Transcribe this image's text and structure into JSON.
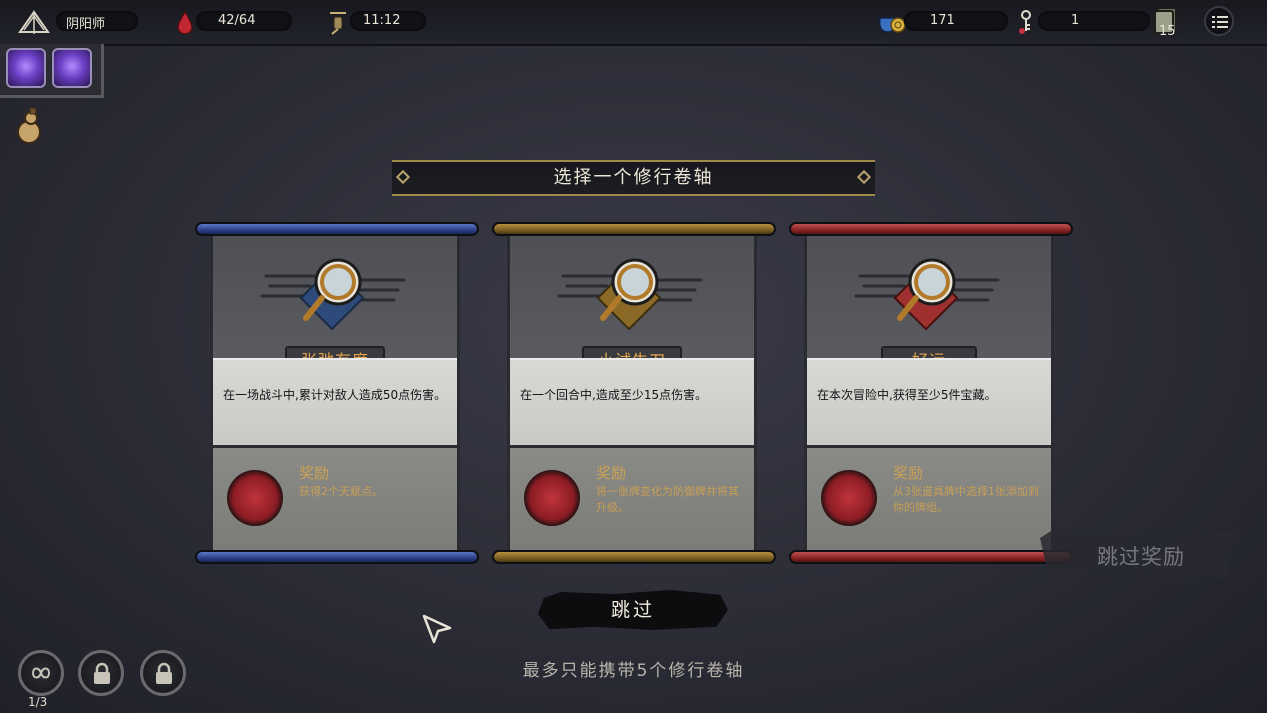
{
  "topbar": {
    "character_name": "阴阳师",
    "hp": "42/64",
    "time": "11:12",
    "gold": "171",
    "keys": "1",
    "deck_count": "15",
    "icons": {
      "character": "yin-yang-fan-icon",
      "hp": "blood-drop-icon",
      "time": "lantern-icon",
      "gold": "coin-pouch-icon",
      "keys": "key-icon",
      "deck": "deck-icon",
      "menu": "menu-list-icon"
    }
  },
  "banner": {
    "title": "选择一个修行卷轴"
  },
  "cards": [
    {
      "color": "#3b55a8",
      "title": "张弛有度",
      "desc": "在一场战斗中,累计对敌人造成50点伤害。",
      "reward_label": "奖励",
      "reward_text": "获得2个天赋点。"
    },
    {
      "color": "#8a6a26",
      "title": "小试牛刀",
      "desc": "在一个回合中,造成至少15点伤害。",
      "reward_label": "奖励",
      "reward_text": "将一张牌变化为防御牌并将其升级。"
    },
    {
      "color": "#a02f2f",
      "title": "好运",
      "desc": "在本次冒险中,获得至少5件宝藏。",
      "reward_label": "奖励",
      "reward_text": "从3张道具牌中选择1张添加到你的牌组。"
    }
  ],
  "skip_button": "跳过",
  "skip_reward": "跳过奖励",
  "limit_text": "最多只能携带5个修行卷轴",
  "slots": {
    "count": "1/3"
  }
}
